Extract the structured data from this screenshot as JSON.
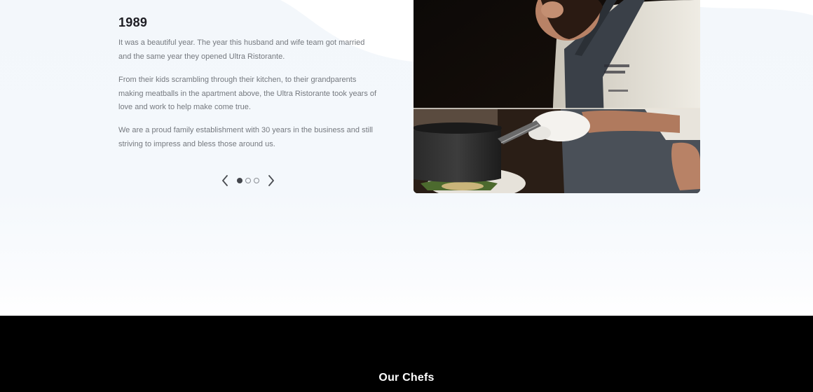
{
  "story": {
    "year": "1989",
    "paragraphs": [
      "It was a beautiful year. The year this husband and wife team got married and the same year they opened Ultra Ristorante.",
      "From their kids scrambling through their kitchen, to their grandparents making meatballs in the apartment above, the Ultra Ristorante took years of love and work to help make come true.",
      "We are a proud family establishment with 30 years in the business and still striving to impress and bless those around us."
    ],
    "carousel": {
      "prev_icon": "chevron-left-icon",
      "next_icon": "chevron-right-icon",
      "slide_count": 3,
      "active_index": 0
    }
  },
  "photo": {
    "subject": "chef-cooking-photo"
  },
  "chefs_section": {
    "title": "Our Chefs"
  },
  "colors": {
    "section_bg": "#f3f7fb",
    "heading": "#1e1e24",
    "body_text": "#75797f",
    "footer_bg": "#000000",
    "footer_text": "#ffffff"
  }
}
